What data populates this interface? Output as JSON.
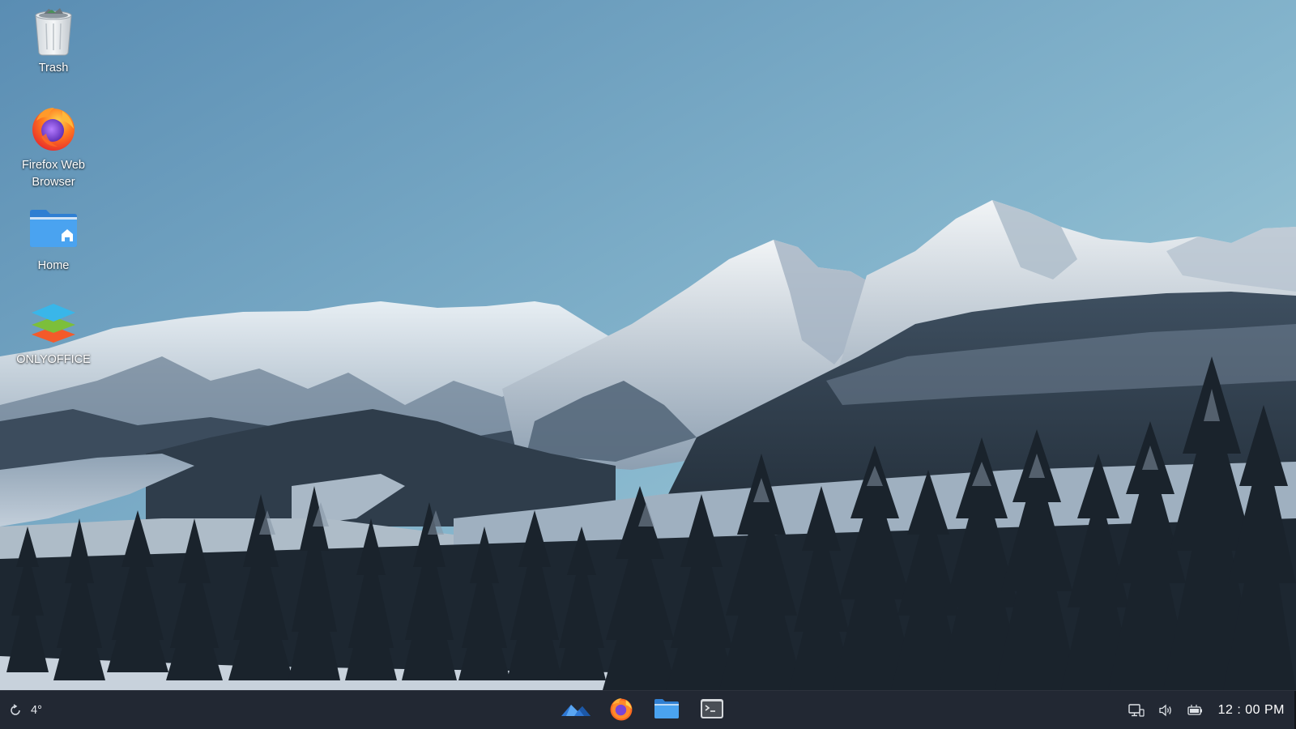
{
  "desktop": {
    "icons": [
      {
        "label": "Trash",
        "icon": "trash-icon"
      },
      {
        "label": "Firefox Web Browser",
        "icon": "firefox-icon"
      },
      {
        "label": "Home",
        "icon": "home-folder-icon"
      },
      {
        "label": "ONLYOFFICE",
        "icon": "onlyoffice-icon"
      }
    ]
  },
  "taskbar": {
    "weather": {
      "icon": "weather-refresh-icon",
      "temperature": "4°"
    },
    "pinned_apps": [
      {
        "icon": "app-launcher-icon"
      },
      {
        "icon": "firefox-icon"
      },
      {
        "icon": "file-manager-icon"
      },
      {
        "icon": "terminal-icon"
      }
    ],
    "tray": [
      {
        "icon": "network-icon"
      },
      {
        "icon": "volume-icon"
      },
      {
        "icon": "battery-icon"
      }
    ],
    "clock": "12 : 00 PM"
  },
  "colors": {
    "taskbar_bg": "#222933",
    "folder_blue": "#3d8fe0",
    "sky_top": "#5a8db3",
    "sky_bottom": "#aad0dc"
  }
}
